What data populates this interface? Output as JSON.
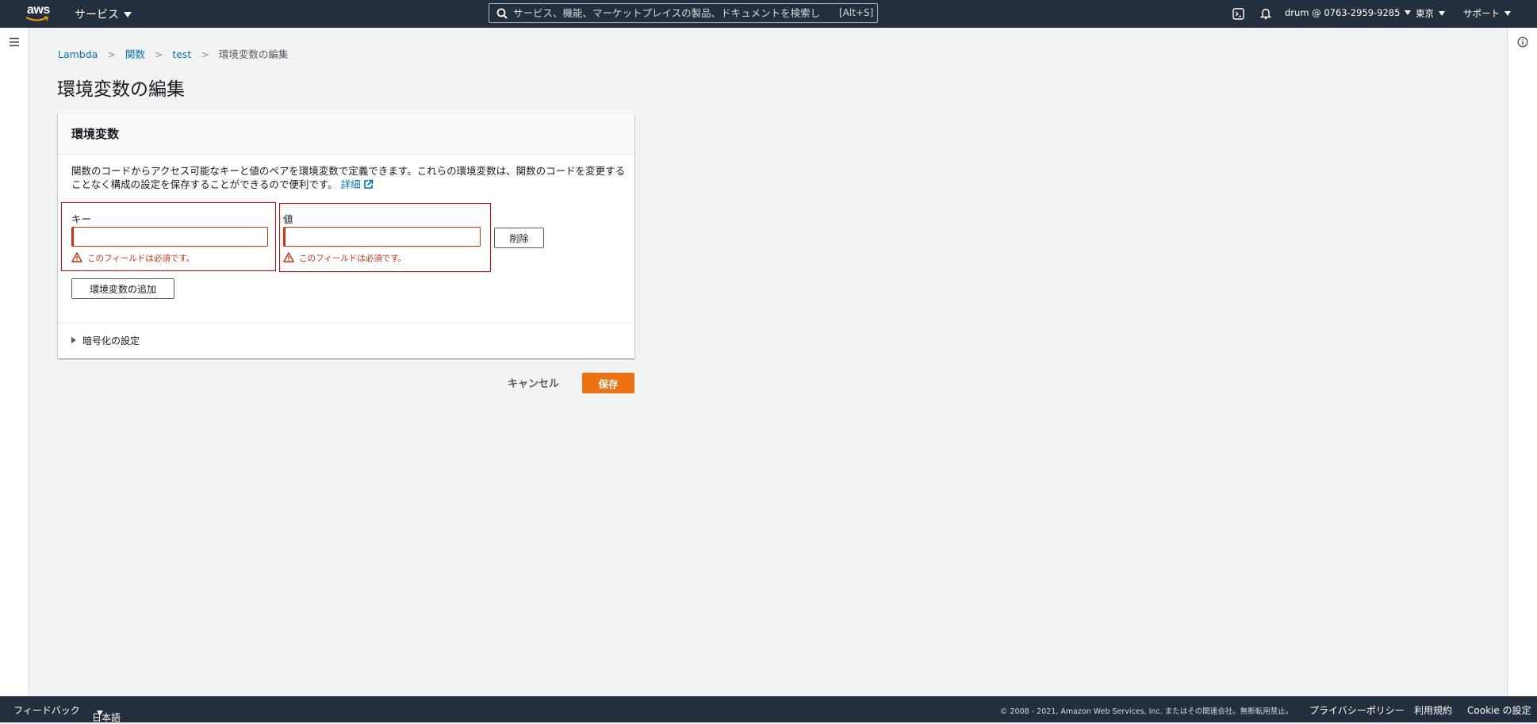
{
  "header": {
    "logo_text": "aws",
    "services_label": "サービス",
    "search_placeholder": "サービス、機能、マーケットプレイスの製品、ドキュメントを検索し",
    "search_shortcut": "[Alt+S]",
    "account_label": "drum @ 0763-2959-9285",
    "region_label": "東京",
    "support_label": "サポート"
  },
  "breadcrumb": {
    "items": [
      "Lambda",
      "関数",
      "test"
    ],
    "current": "環境変数の編集"
  },
  "page_title": "環境変数の編集",
  "panel": {
    "title": "環境変数",
    "description": "関数のコードからアクセス可能なキーと値のペアを環境変数で定義できます。これらの環境変数は、関数のコードを変更することなく構成の設定を保存することができるので便利です。",
    "learn_more": "詳細",
    "key_label": "キー",
    "key_value": "",
    "key_error": "このフィールドは必須です。",
    "value_label": "値",
    "value_value": "",
    "value_error": "このフィールドは必須です。",
    "delete_label": "削除",
    "add_label": "環境変数の追加",
    "encryption_label": "暗号化の設定"
  },
  "actions": {
    "cancel_label": "キャンセル",
    "save_label": "保存"
  },
  "footer": {
    "feedback_label": "フィードバック",
    "language_label": "日本語",
    "copyright": "© 2008 - 2021, Amazon Web Services, Inc. またはその関連会社。無断転用禁止。",
    "privacy_label": "プライバシーポリシー",
    "terms_label": "利用規約",
    "cookie_label": "Cookie の設定"
  },
  "colors": {
    "nav_bg": "#232f3e",
    "link": "#0073bb",
    "error": "#d13212",
    "primary": "#ec7211"
  }
}
